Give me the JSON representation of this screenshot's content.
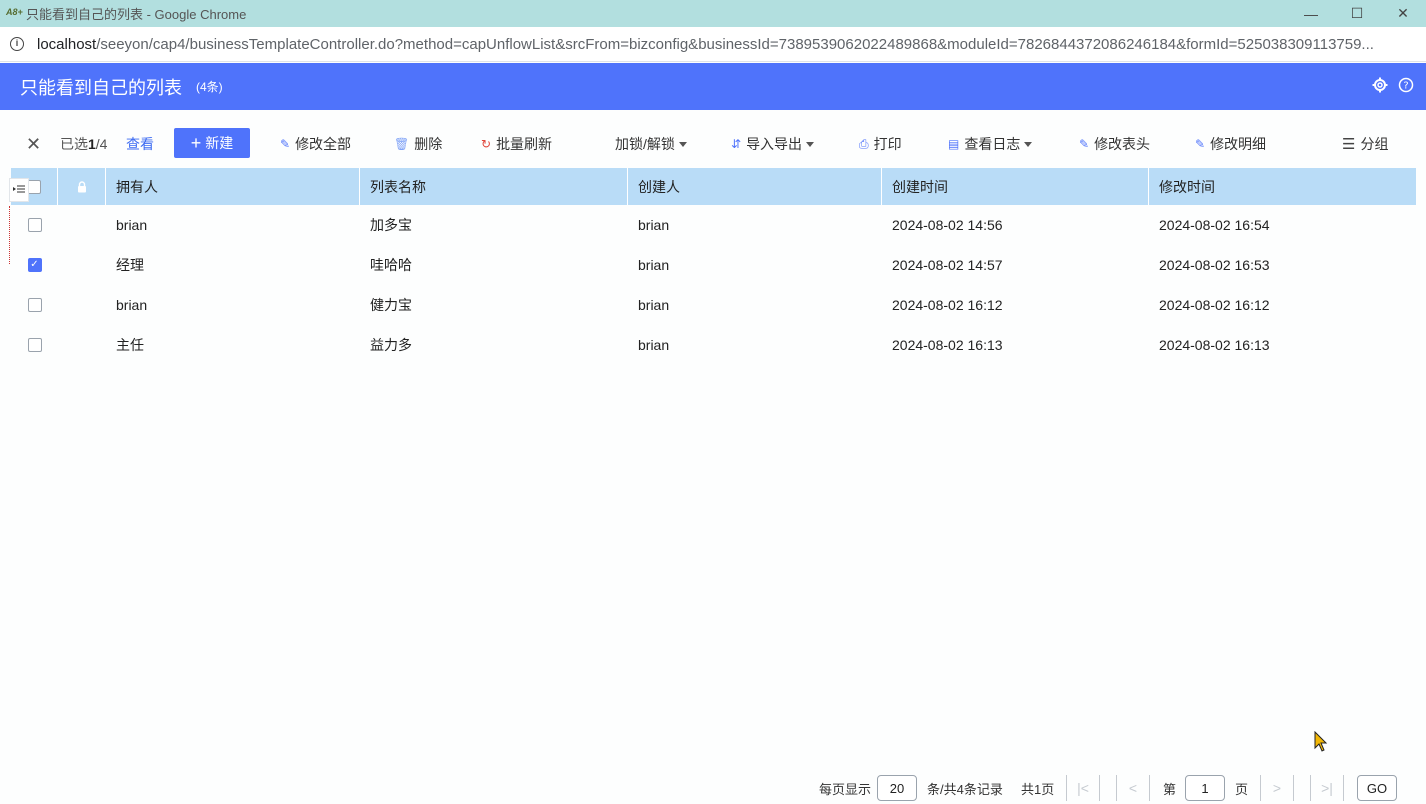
{
  "browser": {
    "window_title": "只能看到自己的列表 - Google Chrome",
    "logo_text": "A8+",
    "url_host": "localhost",
    "url_path": "/seeyon/cap4/businessTemplateController.do?method=capUnflowList&srcFrom=bizconfig&businessId=7389539062022489868&moduleId=7826844372086246184&formId=525038309113759..."
  },
  "header": {
    "title": "只能看到自己的列表",
    "count": "(4条)"
  },
  "toolbar": {
    "selected_prefix": "已选",
    "selected_count": "1",
    "selected_total": "/4",
    "view": "查看",
    "new": "新建",
    "edit_all": "修改全部",
    "delete": "删除",
    "batch_refresh": "批量刷新",
    "lock_unlock": "加锁/解锁",
    "import_export": "导入导出",
    "print": "打印",
    "view_log": "查看日志",
    "edit_header": "修改表头",
    "edit_detail": "修改明细",
    "group": "分组"
  },
  "table": {
    "columns": [
      "拥有人",
      "列表名称",
      "创建人",
      "创建时间",
      "修改时间"
    ],
    "rows": [
      {
        "checked": false,
        "owner": "brian",
        "name": "加多宝",
        "creator": "brian",
        "created": "2024-08-02 14:56",
        "modified": "2024-08-02 16:54"
      },
      {
        "checked": true,
        "owner": "经理",
        "name": "哇哈哈",
        "creator": "brian",
        "created": "2024-08-02 14:57",
        "modified": "2024-08-02 16:53"
      },
      {
        "checked": false,
        "owner": "brian",
        "name": "健力宝",
        "creator": "brian",
        "created": "2024-08-02 16:12",
        "modified": "2024-08-02 16:12"
      },
      {
        "checked": false,
        "owner": "主任",
        "name": "益力多",
        "creator": "brian",
        "created": "2024-08-02 16:13",
        "modified": "2024-08-02 16:13"
      }
    ]
  },
  "pager": {
    "per_page_label": "每页显示",
    "per_page_value": "20",
    "records_label": "条/共4条记录",
    "total_pages": "共1页",
    "page_prefix": "第",
    "page_value": "1",
    "page_suffix": "页",
    "go": "GO"
  },
  "colors": {
    "header_bg": "#4f73fb",
    "table_header_bg": "#b9dcf7",
    "titlebar_bg": "#b2dfdf"
  }
}
